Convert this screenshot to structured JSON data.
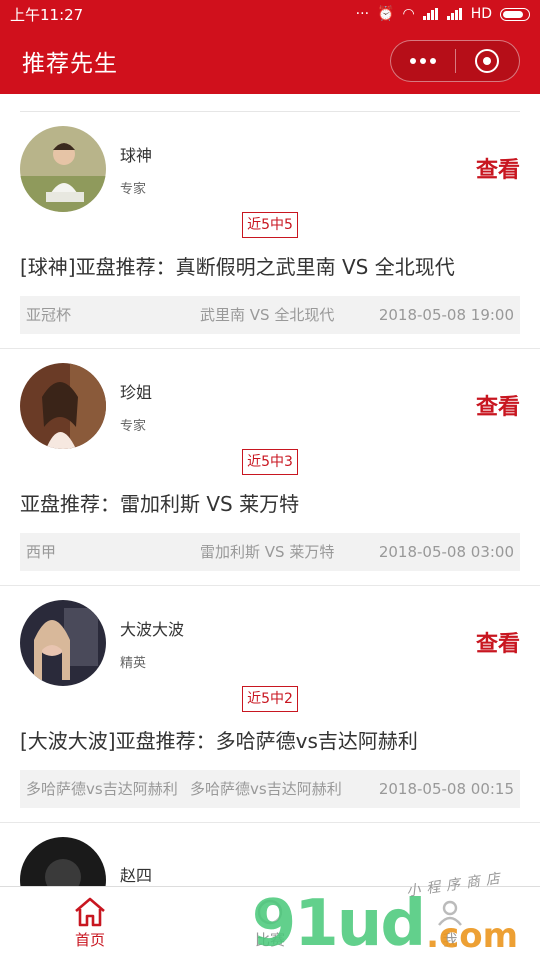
{
  "status_bar": {
    "time": "上午11:27",
    "network": "HD"
  },
  "nav": {
    "title": "推荐先生"
  },
  "cards": [
    {
      "name": "球神",
      "tag": "专家",
      "view_label": "查看",
      "record": "近5中5",
      "title": "[球神]亚盘推荐：真断假明之武里南 VS 全北现代",
      "league": "亚冠杯",
      "match": "武里南 VS 全北现代",
      "datetime": "2018-05-08 19:00"
    },
    {
      "name": "珍姐",
      "tag": "专家",
      "view_label": "查看",
      "record": "近5中3",
      "title": "亚盘推荐：雷加利斯 VS 莱万特",
      "league": "西甲",
      "match": "雷加利斯 VS 莱万特",
      "datetime": "2018-05-08 03:00"
    },
    {
      "name": "大波大波",
      "tag": "精英",
      "view_label": "查看",
      "record": "近5中2",
      "title": "[大波大波]亚盘推荐：多哈萨德vs吉达阿赫利",
      "league": "多哈萨德vs吉达阿赫利",
      "match": "多哈萨德vs吉达阿赫利",
      "datetime": "2018-05-08 00:15"
    },
    {
      "name": "赵四"
    }
  ],
  "tabbar": {
    "home_label": "首页",
    "second_label": "比赛",
    "third_label": "我"
  },
  "watermark": {
    "brand": "91ud",
    "domain": ".com",
    "caption": "小程序商店"
  },
  "colors": {
    "brand_red": "#d0101c",
    "accent_red": "#c81620"
  }
}
